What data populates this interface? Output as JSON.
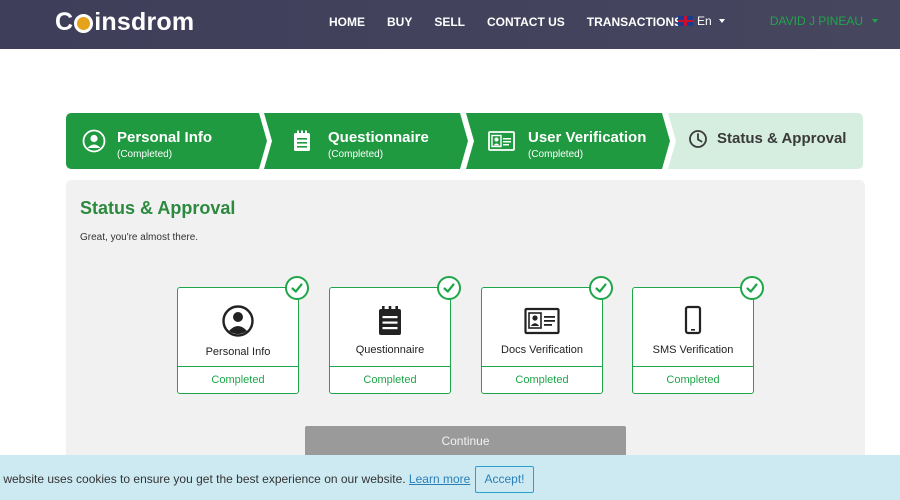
{
  "header": {
    "logo_text_pre": "C",
    "logo_text_post": "insdrom",
    "nav": [
      "HOME",
      "BUY",
      "SELL",
      "CONTACT US",
      "TRANSACTIONS"
    ],
    "language": "En",
    "user_name": "DAVID J PINEAU"
  },
  "stepper": {
    "steps": [
      {
        "title": "Personal Info",
        "status": "(Completed)",
        "icon": "user-circle-icon"
      },
      {
        "title": "Questionnaire",
        "status": "(Completed)",
        "icon": "clipboard-list-icon"
      },
      {
        "title": "User Verification",
        "status": "(Completed)",
        "icon": "id-card-icon"
      },
      {
        "title": "Status & Approval",
        "status": "",
        "icon": "clock-icon"
      }
    ]
  },
  "main": {
    "title": "Status & Approval",
    "subtitle": "Great, you're almost there.",
    "tiles": [
      {
        "label": "Personal Info",
        "status": "Completed",
        "icon": "user-circle-icon"
      },
      {
        "label": "Questionnaire",
        "status": "Completed",
        "icon": "clipboard-list-icon"
      },
      {
        "label": "Docs Verification",
        "status": "Completed",
        "icon": "id-card-icon"
      },
      {
        "label": "SMS Verification",
        "status": "Completed",
        "icon": "mobile-phone-icon"
      }
    ],
    "continue_label": "Continue"
  },
  "cookie": {
    "text": "s website uses cookies to ensure you get the best experience on our website.",
    "link": "Learn more",
    "accept": "Accept!"
  },
  "colors": {
    "accent_green": "#1fa64a",
    "step_active_bg": "#d6eee0",
    "header_bg": "#3e3e5a",
    "cookie_bg": "#cdeaf2"
  }
}
